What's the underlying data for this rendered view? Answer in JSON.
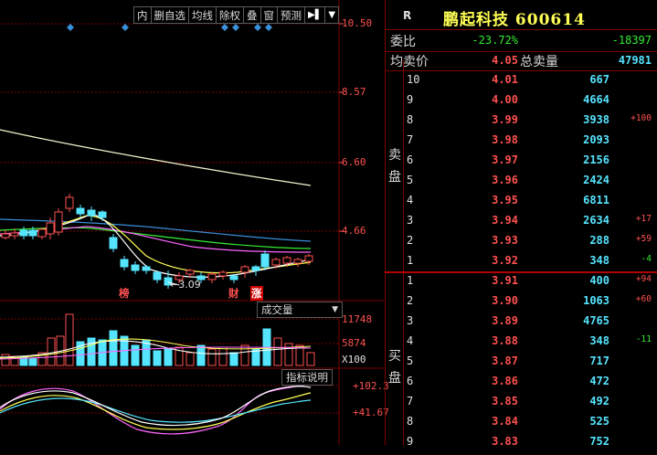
{
  "toolbar": {
    "items": [
      "内",
      "删自选",
      "均线",
      "除权",
      "叠",
      "窗",
      "预测",
      "▶▌",
      "▼"
    ]
  },
  "price_axis": [
    "10.50",
    "8.57",
    "6.60",
    "4.66"
  ],
  "low_marker": "3.09",
  "event_tags": [
    "榜",
    "财",
    "涨"
  ],
  "volume_panel": {
    "button": "成交量",
    "button_arrow": "▼",
    "axis": [
      "11748",
      "5874",
      "X100"
    ]
  },
  "indicator_panel": {
    "button": "指标说明",
    "axis": [
      "+102.3",
      "+41.67"
    ]
  },
  "quote": {
    "badge": "R",
    "name": "鹏起科技",
    "code": "600614",
    "wei_bi_label": "委比",
    "wei_bi_pct": "-23.72%",
    "wei_bi_diff": "-18397",
    "avg_label": "均卖价",
    "avg_value": "4.05",
    "total_label": "总卖量",
    "total_value": "47981",
    "sell_label": "卖盘",
    "buy_label": "买盘",
    "sell": [
      {
        "level": "10",
        "price": "4.01",
        "volume": "667",
        "change": ""
      },
      {
        "level": "9",
        "price": "4.00",
        "volume": "4664",
        "change": ""
      },
      {
        "level": "8",
        "price": "3.99",
        "volume": "3938",
        "change": "+100"
      },
      {
        "level": "7",
        "price": "3.98",
        "volume": "2093",
        "change": ""
      },
      {
        "level": "6",
        "price": "3.97",
        "volume": "2156",
        "change": ""
      },
      {
        "level": "5",
        "price": "3.96",
        "volume": "2424",
        "change": ""
      },
      {
        "level": "4",
        "price": "3.95",
        "volume": "6811",
        "change": ""
      },
      {
        "level": "3",
        "price": "3.94",
        "volume": "2634",
        "change": "+17"
      },
      {
        "level": "2",
        "price": "3.93",
        "volume": "288",
        "change": "+59"
      },
      {
        "level": "1",
        "price": "3.92",
        "volume": "348",
        "change": "-4"
      }
    ],
    "buy": [
      {
        "level": "1",
        "price": "3.91",
        "volume": "400",
        "change": "+94"
      },
      {
        "level": "2",
        "price": "3.90",
        "volume": "1063",
        "change": "+60"
      },
      {
        "level": "3",
        "price": "3.89",
        "volume": "4765",
        "change": ""
      },
      {
        "level": "4",
        "price": "3.88",
        "volume": "348",
        "change": "-11"
      },
      {
        "level": "5",
        "price": "3.87",
        "volume": "717",
        "change": ""
      },
      {
        "level": "6",
        "price": "3.86",
        "volume": "472",
        "change": ""
      },
      {
        "level": "7",
        "price": "3.85",
        "volume": "492",
        "change": ""
      },
      {
        "level": "8",
        "price": "3.84",
        "volume": "525",
        "change": ""
      },
      {
        "level": "9",
        "price": "3.83",
        "volume": "752",
        "change": ""
      }
    ]
  },
  "colors": {
    "up": "#ff5050",
    "down": "#55e5ff",
    "green": "#33ee33",
    "yellow": "#ffff55",
    "grid": "#7a0000"
  }
}
